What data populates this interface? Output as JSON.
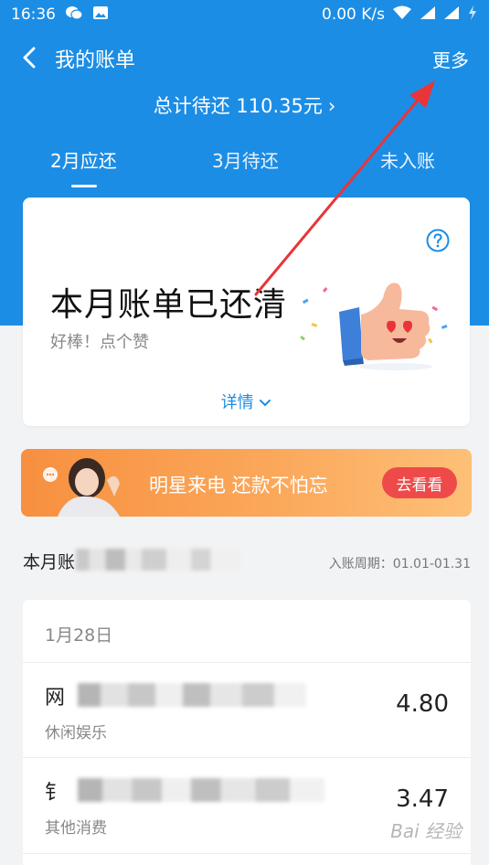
{
  "status_bar": {
    "time": "16:36",
    "network_speed": "0.00 K/s",
    "icons": [
      "wechat-icon",
      "image-icon",
      "wifi-icon",
      "signal-icon",
      "signal-icon",
      "charging-icon"
    ]
  },
  "nav": {
    "title": "我的账单",
    "more_label": "更多",
    "back_icon": "chevron-left-icon"
  },
  "total_due": {
    "text": "总计待还 110.35元",
    "chevron": "›"
  },
  "tabs": [
    {
      "label": "2月应还",
      "active": true
    },
    {
      "label": "3月待还",
      "active": false
    },
    {
      "label": "未入账",
      "active": false
    }
  ],
  "bill_card": {
    "title": "本月账单已还清",
    "subtitle": "好棒！点个赞",
    "details_label": "详情",
    "help_icon": "question-circle-icon"
  },
  "promo": {
    "text": "明星来电 还款不怕忘",
    "button_label": "去看看"
  },
  "summary": {
    "label": "本月账",
    "cycle_text": "入账周期：01.01-01.31"
  },
  "transactions": {
    "date": "1月28日",
    "items": [
      {
        "name_visible": "网",
        "category": "休闲娱乐",
        "amount": "4.80"
      },
      {
        "name_visible": "钅",
        "category": "其他消费",
        "amount": "3.47"
      }
    ]
  },
  "watermark": {
    "text": "Bai 经验"
  },
  "colors": {
    "primary": "#1c8de5",
    "promo_button": "#ee4a4a",
    "annotation_arrow": "#e8353a"
  }
}
